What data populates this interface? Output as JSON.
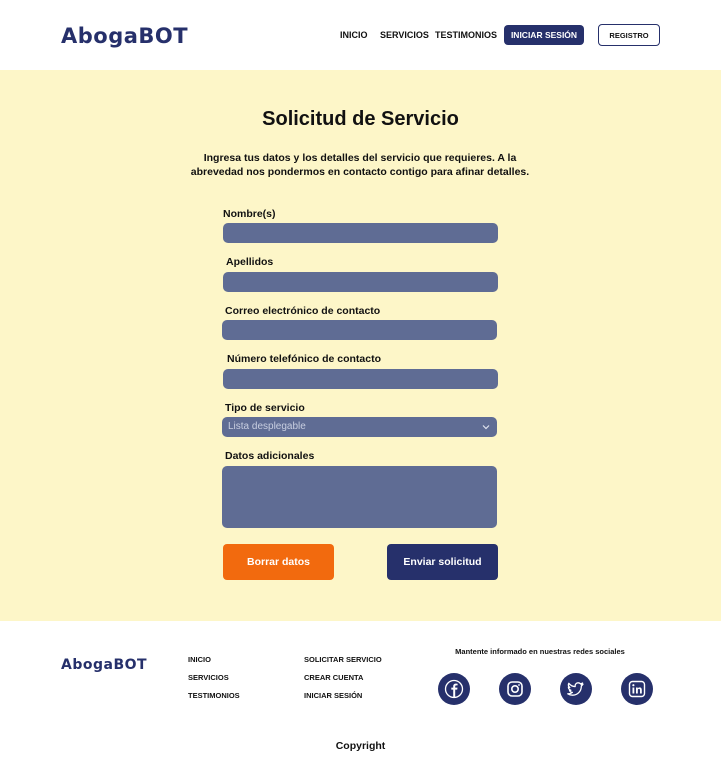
{
  "header": {
    "logo": "AbogaBOT",
    "nav": [
      "INICIO",
      "SERVICIOS",
      "TESTIMONIOS"
    ],
    "login_label": "INICIAR SESIÓN",
    "register_label": "REGISTRO"
  },
  "form": {
    "title": "Solicitud de Servicio",
    "description": "Ingresa tus datos y los detalles del servicio que requieres. A la abrevedad nos pondermos en contacto contigo para afinar detalles.",
    "fields": {
      "nombres": "Nombre(s)",
      "apellidos": "Apellidos",
      "correo": "Correo electrónico de contacto",
      "telefono": "Número telefónico de contacto",
      "tipo": "Tipo de servicio",
      "datos": "Datos adicionales"
    },
    "select_placeholder": "Lista desplegable",
    "clear_label": "Borrar datos",
    "send_label": "Enviar solicitud"
  },
  "footer": {
    "logo": "AbogaBOT",
    "col1": [
      "INICIO",
      "SERVICIOS",
      "TESTIMONIOS"
    ],
    "col2": [
      "SOLICITAR SERVICIO",
      "CREAR CUENTA",
      "INICIAR SESIÓN"
    ],
    "social_title": "Mantente informado en nuestras redes sociales",
    "social_icons": [
      "facebook-icon",
      "instagram-icon",
      "twitter-icon",
      "linkedin-icon"
    ],
    "copyright": "Copyright"
  },
  "colors": {
    "brand": "#26306b",
    "accent": "#f26a0e",
    "background_form": "#fdf6c8",
    "field": "#5f6c94"
  }
}
